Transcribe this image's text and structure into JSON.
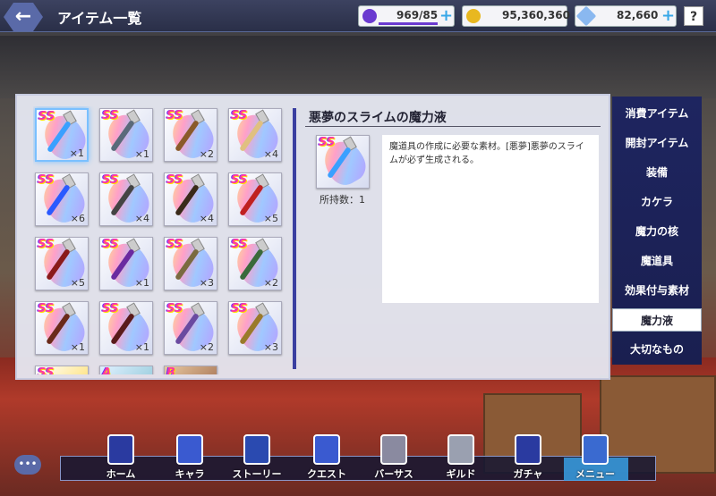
{
  "header": {
    "back_icon": "back-arrow-icon",
    "title": "アイテム一覧",
    "stamina": "969/85",
    "gold": "95,360,360",
    "crystal": "82,660",
    "help": "?"
  },
  "grid": {
    "items": [
      {
        "rank": "SS",
        "qty": "×1",
        "color": "#3aa0ff"
      },
      {
        "rank": "SS",
        "qty": "×1",
        "color": "#5a6a7a"
      },
      {
        "rank": "SS",
        "qty": "×2",
        "color": "#8a5a2a"
      },
      {
        "rank": "SS",
        "qty": "×4",
        "color": "#e0c080"
      },
      {
        "rank": "SS",
        "qty": "×6",
        "color": "#2a5aff"
      },
      {
        "rank": "SS",
        "qty": "×4",
        "color": "#444444"
      },
      {
        "rank": "SS",
        "qty": "×4",
        "color": "#3a2a1a"
      },
      {
        "rank": "SS",
        "qty": "×5",
        "color": "#c02020"
      },
      {
        "rank": "SS",
        "qty": "×5",
        "color": "#8a1a1a"
      },
      {
        "rank": "SS",
        "qty": "×1",
        "color": "#6a2aa0"
      },
      {
        "rank": "SS",
        "qty": "×3",
        "color": "#7a6a40"
      },
      {
        "rank": "SS",
        "qty": "×2",
        "color": "#3a6a3a"
      },
      {
        "rank": "SS",
        "qty": "×1",
        "color": "#6a2a1a"
      },
      {
        "rank": "SS",
        "qty": "×1",
        "color": "#5a1a1a"
      },
      {
        "rank": "SS",
        "qty": "×2",
        "color": "#6a4aa0"
      },
      {
        "rank": "SS",
        "qty": "×3",
        "color": "#9a7a2a"
      }
    ],
    "partial_ranks": [
      "SS",
      "A",
      "B"
    ]
  },
  "detail": {
    "title": "悪夢のスライムの魔力液",
    "rank": "SS",
    "owned": "所持数：1",
    "description": "魔道具の作成に必要な素材。[悪夢]悪夢のスライムが必ず生成される。"
  },
  "side_menu": [
    "消費アイテム",
    "開封アイテム",
    "装備",
    "カケラ",
    "魔力の核",
    "魔道具",
    "効果付与素材",
    "魔力液",
    "大切なもの"
  ],
  "nav": [
    {
      "label": "ホーム",
      "icon": "home-tower-icon"
    },
    {
      "label": "キャラ",
      "icon": "character-icon"
    },
    {
      "label": "ストーリー",
      "icon": "book-icon"
    },
    {
      "label": "クエスト",
      "icon": "quest-icon"
    },
    {
      "label": "バーサス",
      "icon": "crossed-swords-icon"
    },
    {
      "label": "ギルド",
      "icon": "shield-icon"
    },
    {
      "label": "ガチャ",
      "icon": "gacha-icon"
    },
    {
      "label": "メニュー",
      "icon": "menu-icon"
    }
  ],
  "colors": {
    "accent": "#3aa8f0",
    "menu_bg": "#1e2560",
    "stamina": "#6a3ad0"
  }
}
